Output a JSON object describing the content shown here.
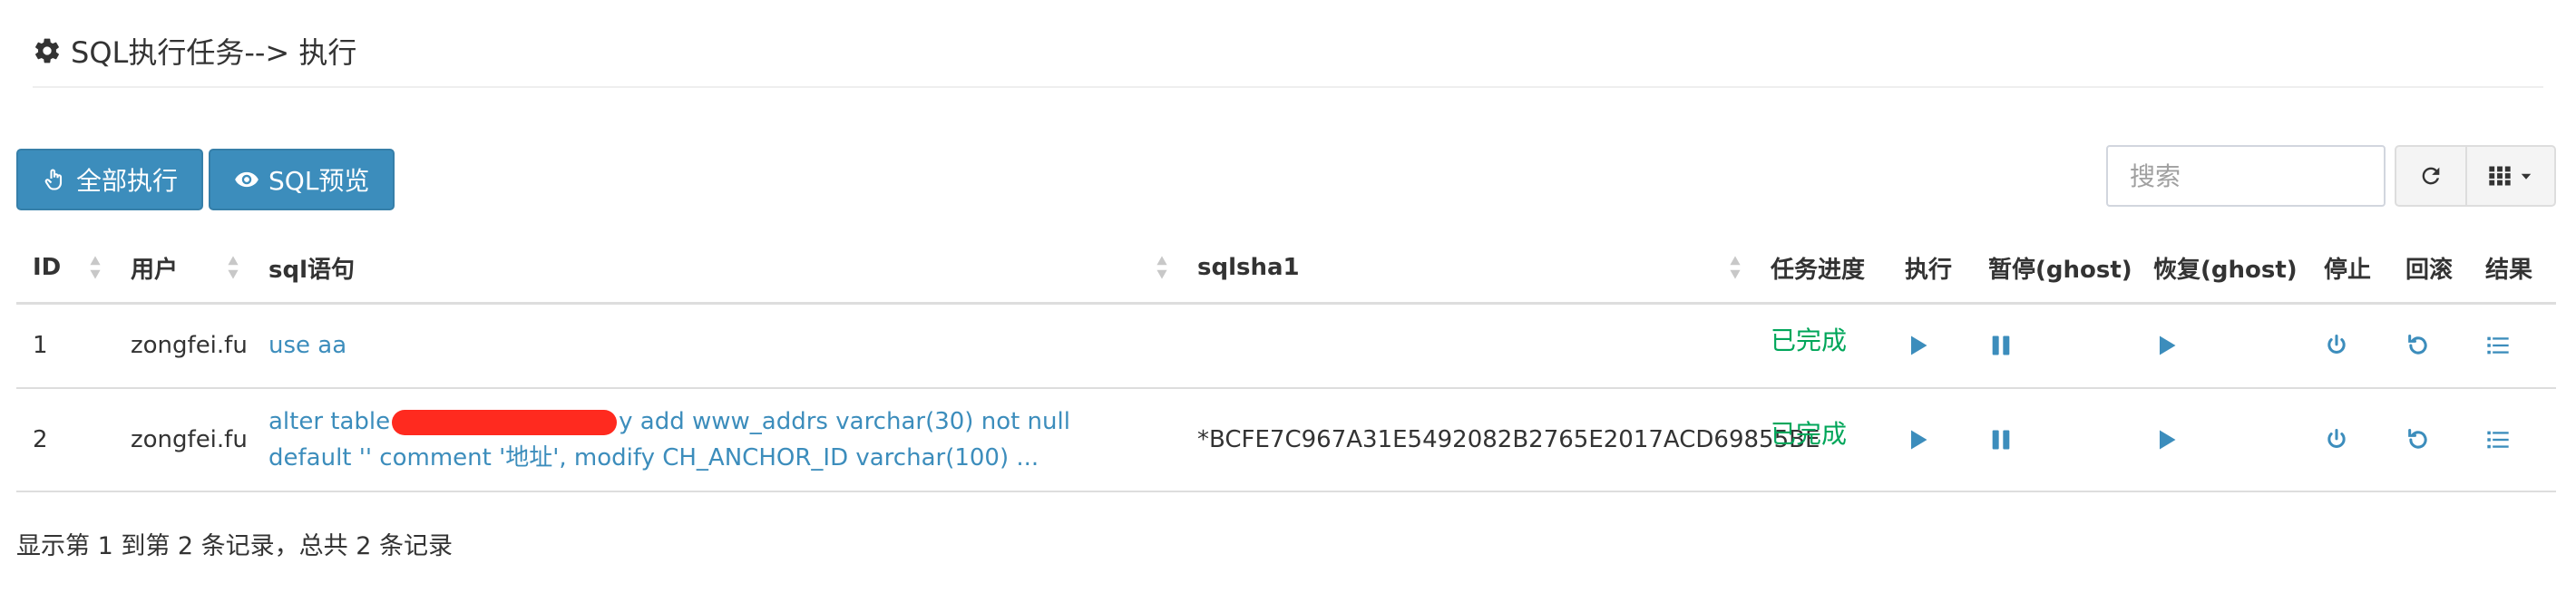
{
  "header": {
    "title": "SQL执行任务--> 执行"
  },
  "toolbar": {
    "run_all_label": "全部执行",
    "preview_label": "SQL预览",
    "search_placeholder": "搜索"
  },
  "table": {
    "columns": [
      "ID",
      "用户",
      "sql语句",
      "sqlsha1",
      "任务进度",
      "执行",
      "暂停(ghost)",
      "恢复(ghost)",
      "停止",
      "回滚",
      "结果"
    ],
    "rows": [
      {
        "id": "1",
        "user": "zongfei.fu",
        "sql": "use aa",
        "sql_before": "",
        "sql_after": "",
        "sqlsha1": "",
        "status": "已完成"
      },
      {
        "id": "2",
        "user": "zongfei.fu",
        "sql": "",
        "sql_before": "alter table",
        "sql_after": "y add www_addrs varchar(30) not null default '' comment '地址', modify CH_ANCHOR_ID varchar(100)  ...",
        "sqlsha1": "*BCFE7C967A31E5492082B2765E2017ACD69855BE",
        "status": "已完成"
      }
    ]
  },
  "footer": {
    "summary": "显示第 1 到第 2 条记录，总共 2 条记录"
  },
  "icons": {
    "header": "gear-icon",
    "run_all": "hand-pointer-icon",
    "preview": "eye-icon",
    "refresh": "refresh-icon",
    "columns": "grid-icon",
    "row_actions": [
      "play-icon",
      "pause-icon",
      "play-icon",
      "power-icon",
      "undo-icon",
      "list-icon"
    ]
  },
  "colors": {
    "primary": "#3c8dbc",
    "success": "#00a65a",
    "redaction": "#ff2a1f"
  }
}
